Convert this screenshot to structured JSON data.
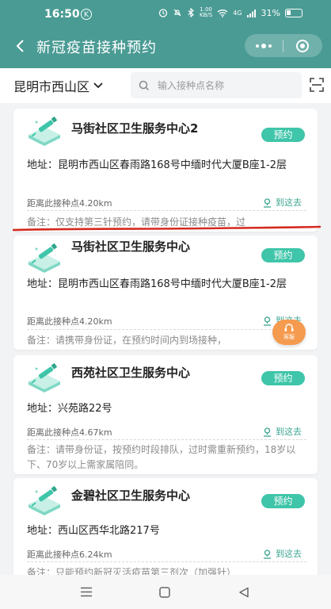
{
  "status_bar": {
    "time": "16:50",
    "badge": "K",
    "net_speed": "1.00",
    "net_unit": "KB/S",
    "signal": "4G",
    "battery": "31%"
  },
  "nav": {
    "title": "新冠疫苗接种预约"
  },
  "filter": {
    "district": "昆明市西山区",
    "search_placeholder": "输入接种点名称"
  },
  "cards": [
    {
      "name": "马街社区卫生服务中心2",
      "button": "预约",
      "address": "地址：昆明市西山区春雨路168号中缅时代大厦B座1-2层",
      "distance": "距离此接种点4.20km",
      "go": "到这去",
      "note": "备注：仅支持第三针预约，请带身份证接种疫苗，过"
    },
    {
      "name": "马街社区卫生服务中心",
      "button": "预约",
      "address": "地址：昆明市西山区春雨路168号中缅时代大厦B座1-2层",
      "distance": "距离此接种点4.20km",
      "go": "到这去",
      "note": "备注：请携带身份证，在预约时间内到场接种，"
    },
    {
      "name": "西苑社区卫生服务中心",
      "button": "预约",
      "address": "地址：兴苑路22号",
      "distance": "距离此接种点4.67km",
      "go": "到这去",
      "note": "备注：请带身份证，按预约时段排队，过时需重新预约，18岁以下、70岁以上需家属陪同。"
    },
    {
      "name": "金碧社区卫生服务中心",
      "button": "预约",
      "address": "地址：西山区西华北路217号",
      "distance": "距离此接种点6.24km",
      "go": "到这去",
      "note": "备注：只能预约新冠灭活疫苗第三剂次（加强针）"
    }
  ],
  "float_service": {
    "label": "客服"
  },
  "colors": {
    "header": "#4a9b94",
    "accent": "#3fc5a9",
    "link": "#3aa58f",
    "annotation": "#d42a20",
    "service": "#f59b4f"
  },
  "icons": [
    "back-icon",
    "more-icon",
    "close-icon",
    "chevron-down-icon",
    "search-icon",
    "scan-icon",
    "vaccine-logo-icon",
    "location-icon",
    "service-icon",
    "menu-icon",
    "home-icon",
    "back-nav-icon"
  ]
}
